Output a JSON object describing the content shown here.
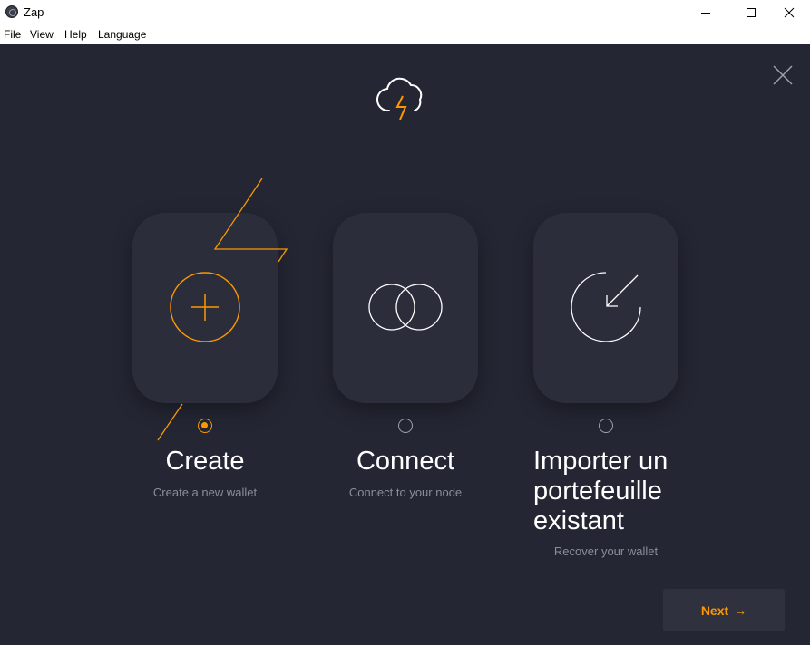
{
  "window": {
    "title": "Zap"
  },
  "menu": {
    "file": "File",
    "view": "View",
    "help": "Help",
    "language": "Language"
  },
  "options": [
    {
      "title": "Create",
      "subtitle": "Create a new wallet",
      "selected": true
    },
    {
      "title": "Connect",
      "subtitle": "Connect to your node",
      "selected": false
    },
    {
      "title_lines": [
        "Importer un",
        "portefeuille",
        "existant"
      ],
      "subtitle": "Recover your wallet",
      "selected": false
    }
  ],
  "footer": {
    "next_label": "Next",
    "next_arrow": "→"
  },
  "colors": {
    "background": "#242633",
    "card": "#2b2d3b",
    "accent": "#fd9800",
    "text": "#ffffff",
    "muted": "#8b8d99"
  },
  "icons": [
    "app-icon",
    "minimize-icon",
    "maximize-icon",
    "close-icon",
    "zap-cloud-logo",
    "plus-circle-icon",
    "linked-circles-icon",
    "import-arrow-icon",
    "close-x-icon"
  ]
}
